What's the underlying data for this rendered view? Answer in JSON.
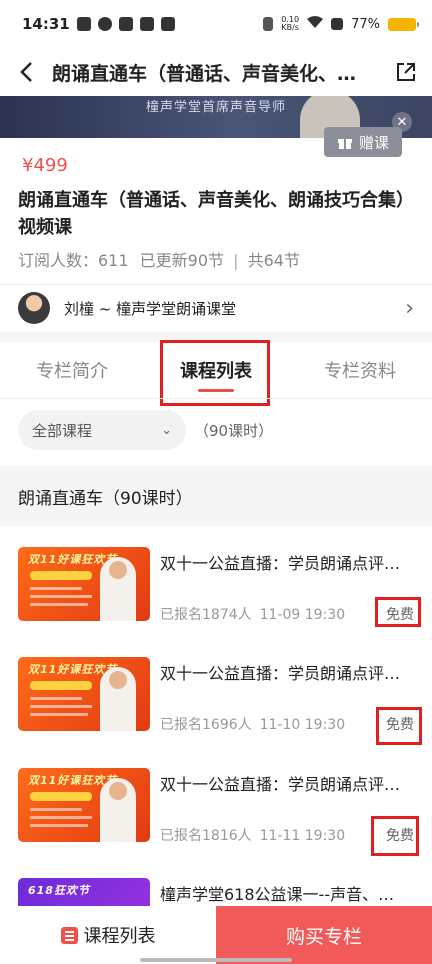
{
  "status_bar": {
    "time": "14:31",
    "net_speed": "0.10",
    "net_unit": "KB/s",
    "battery": "77%",
    "battery_color": "#f4b400"
  },
  "nav": {
    "title": "朗诵直通车（普通话、声音美化、…",
    "back_icon": "chevron-left-icon",
    "share_icon": "share-icon"
  },
  "banner": {
    "text": "橦声学堂首席声音导师",
    "gift_label": "赠课",
    "close_icon": "close-icon"
  },
  "course": {
    "price": "¥499",
    "title": "朗诵直通车（普通话、声音美化、朗诵技巧合集）视频课",
    "subscribers": "订阅人数：611",
    "updated": "已更新90节",
    "separator": "|",
    "total": "共64节"
  },
  "teacher": {
    "name": "刘橦 ~ 橦声学堂朗诵课堂"
  },
  "tabs": [
    {
      "label": "专栏简介"
    },
    {
      "label": "课程列表"
    },
    {
      "label": "专栏资料"
    }
  ],
  "filter": {
    "selected": "全部课程",
    "count": "（90课时）"
  },
  "section": {
    "title": "朗诵直通车（90课时）"
  },
  "lessons": [
    {
      "title": "双十一公益直播：学员朗诵点评…",
      "enrolled": "已报名1874人",
      "time": "11-09 19:30",
      "badge": "免费",
      "thumb_text": "双11好课狂欢节"
    },
    {
      "title": "双十一公益直播：学员朗诵点评…",
      "enrolled": "已报名1696人",
      "time": "11-10 19:30",
      "badge": "免费",
      "thumb_text": "双11好课狂欢节"
    },
    {
      "title": "双十一公益直播：学员朗诵点评…",
      "enrolled": "已报名1816人",
      "time": "11-11 19:30",
      "badge": "免费",
      "thumb_text": "双11好课狂欢节"
    },
    {
      "title": "橦声学堂618公益课一--声音、…",
      "enrolled": "",
      "time": "",
      "badge": "",
      "thumb_text": "618狂欢节"
    }
  ],
  "bottom": {
    "list_label": "课程列表",
    "buy_label": "购买专栏",
    "buy_color": "#f25a5a"
  },
  "colors": {
    "accent": "#f0504a",
    "highlight_box": "#e02020"
  }
}
